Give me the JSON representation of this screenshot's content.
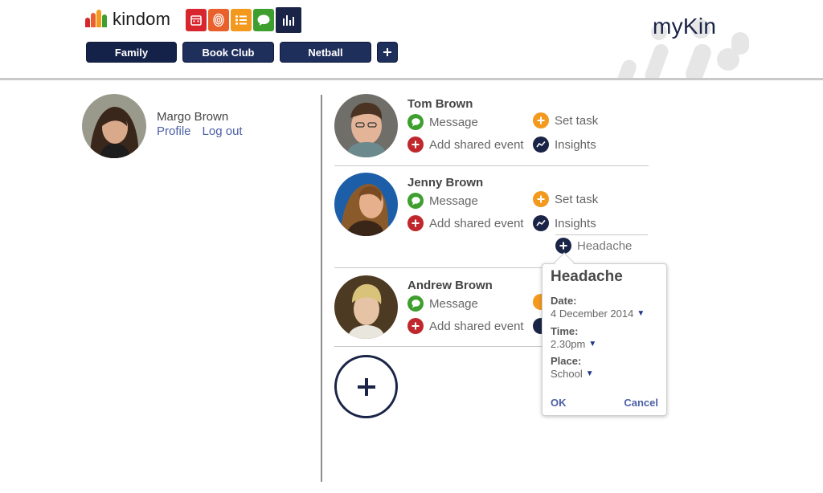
{
  "brand": {
    "name": "kindom",
    "icon": "crown-bars-logo"
  },
  "app_icons": [
    {
      "icon": "calendar-icon",
      "color": "#d7262e"
    },
    {
      "icon": "fingerprint-icon",
      "color": "#e9602a"
    },
    {
      "icon": "list-icon",
      "color": "#f39a1e"
    },
    {
      "icon": "chat-bubble-icon",
      "color": "#3e9e2e"
    },
    {
      "icon": "insights-bars-icon",
      "color": "#1a2447",
      "active": true
    }
  ],
  "tabs": [
    {
      "label": "Family",
      "selected": true
    },
    {
      "label": "Book Club"
    },
    {
      "label": "Netball"
    }
  ],
  "add_group_label": "+",
  "mykin_logo": "myKin",
  "me": {
    "name": "Margo Brown",
    "profile_link": "Profile",
    "logout_link": "Log out"
  },
  "members": [
    {
      "name": "Tom Brown",
      "message": "Message",
      "add_event": "Add shared event",
      "set_task": "Set task",
      "insights": "Insights"
    },
    {
      "name": "Jenny Brown",
      "message": "Message",
      "add_event": "Add shared event",
      "set_task": "Set task",
      "insights": "Insights",
      "insight_item": "Headache"
    },
    {
      "name": "Andrew Brown",
      "message": "Message",
      "add_event": "Add shared event"
    }
  ],
  "add_member_label": "+",
  "popover": {
    "title": "Headache",
    "date_label": "Date:",
    "date_value": "4 December 2014",
    "time_label": "Time:",
    "time_value": "2.30pm",
    "place_label": "Place:",
    "place_value": "School",
    "ok_label": "OK",
    "cancel_label": "Cancel"
  },
  "colors": {
    "navy": "#1a2447",
    "tab": "#1f2f5c",
    "message_green": "#3e9e2e",
    "event_red": "#c0272d",
    "task_orange": "#f39a1e",
    "link_blue": "#4b5fa6"
  }
}
